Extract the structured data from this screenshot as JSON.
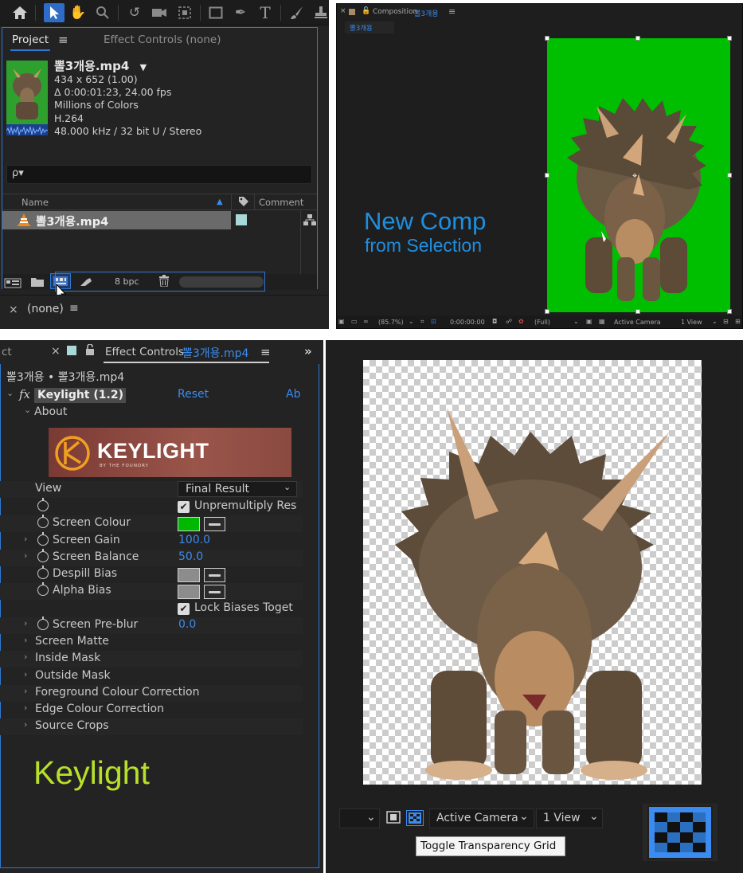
{
  "toolbar": {
    "icons": [
      "home-icon",
      "selection-tool-icon",
      "hand-tool-icon",
      "zoom-tool-icon",
      "rotate-tool-icon",
      "camera-tool-icon",
      "pan-behind-tool-icon",
      "rectangle-tool-icon",
      "pen-tool-icon",
      "type-tool-icon",
      "brush-tool-icon",
      "stamp-tool-icon"
    ]
  },
  "project": {
    "tab_project": "Project",
    "tab_effect_controls": "Effect Controls (none)",
    "file": {
      "name": "뽈3개용.mp4",
      "dimensions": "434 x 652 (1.00)",
      "duration": "Δ 0:00:01:23, 24.00 fps",
      "colors": "Millions of Colors",
      "codec": "H.264",
      "audio": "48.000 kHz / 32 bit U / Stereo"
    },
    "search_icon_label": "ρ▾",
    "columns": {
      "name": "Name",
      "comment": "Comment"
    },
    "row_name": "뽈3개용.mp4",
    "bpc": "8 bpc",
    "lower_panel": {
      "close": "×",
      "label": "(none)",
      "menu": "≡"
    }
  },
  "composition": {
    "tab_prefix": "Composition",
    "tab_name": "뽈3개용",
    "subtab": "뽈3개용",
    "overlay_title": "New Comp",
    "overlay_subtitle": "from Selection",
    "bar": {
      "zoom": "(85.7%)",
      "timecode": "0:00:00:00",
      "resolution": "(Full)",
      "camera": "Active Camera",
      "views": "1 View"
    }
  },
  "effect_controls": {
    "left_tab_fragment": "ct",
    "tab_label": "Effect Controls",
    "tab_target": "뽈3개용.mp4",
    "breadcrumb": "뽈3개용 • 뽈3개용.mp4",
    "effect_name": "Keylight (1.2)",
    "reset": "Reset",
    "about_fragment": "Ab",
    "about": "About",
    "logo_text": "KEYLIGHT",
    "logo_sub": "BY THE FOUNDRY",
    "view_label": "View",
    "view_value": "Final Result",
    "unpremultiply": "Unpremultiply Res",
    "screen_colour": "Screen Colour",
    "screen_colour_hex": "#00b800",
    "screen_gain": "Screen Gain",
    "screen_gain_value": "100.0",
    "screen_balance": "Screen Balance",
    "screen_balance_value": "50.0",
    "despill_bias": "Despill Bias",
    "alpha_bias": "Alpha Bias",
    "lock_biases": "Lock Biases Toget",
    "screen_preblur": "Screen Pre-blur",
    "screen_preblur_value": "0.0",
    "groups": [
      "Screen Matte",
      "Inside Mask",
      "Outside Mask",
      "Foreground Colour Correction",
      "Edge Colour Correction",
      "Source Crops"
    ],
    "overlay_keylight": "Keylight"
  },
  "transparency_view": {
    "camera": "Active Camera",
    "views": "1 View",
    "tooltip": "Toggle Transparency Grid"
  }
}
